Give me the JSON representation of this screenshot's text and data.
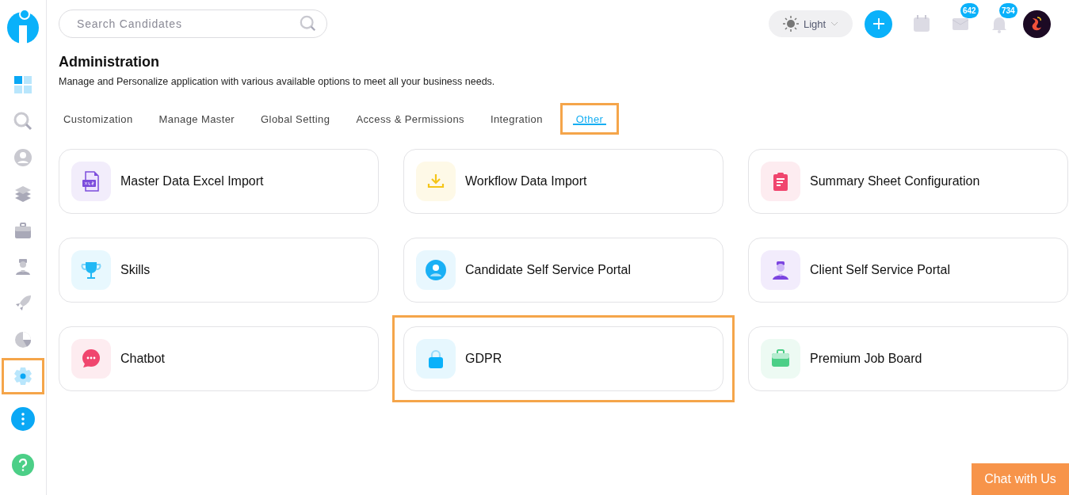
{
  "sidebar": {
    "items": [
      {
        "kind": "dashboard",
        "selected": false,
        "highlighted": false
      },
      {
        "kind": "search",
        "selected": false,
        "highlighted": false
      },
      {
        "kind": "person",
        "selected": false,
        "highlighted": false
      },
      {
        "kind": "layers",
        "selected": false,
        "highlighted": false
      },
      {
        "kind": "briefcase",
        "selected": false,
        "highlighted": false
      },
      {
        "kind": "user",
        "selected": false,
        "highlighted": false
      },
      {
        "kind": "rocket",
        "selected": false,
        "highlighted": false
      },
      {
        "kind": "pie",
        "selected": false,
        "highlighted": false
      },
      {
        "kind": "gear",
        "selected": true,
        "highlighted": true
      }
    ]
  },
  "search": {
    "placeholder": "Search Candidates"
  },
  "theme_toggle": {
    "label": "Light"
  },
  "badges": {
    "mail": "642",
    "notifications": "734"
  },
  "page": {
    "title": "Administration",
    "subtitle": "Manage and Personalize application with various available options to meet all your business needs."
  },
  "tabs": [
    {
      "label": "Customization",
      "selected": false,
      "highlighted": false
    },
    {
      "label": "Manage Master",
      "selected": false,
      "highlighted": false
    },
    {
      "label": "Global Setting",
      "selected": false,
      "highlighted": false
    },
    {
      "label": "Access & Permissions",
      "selected": false,
      "highlighted": false
    },
    {
      "label": "Integration",
      "selected": false,
      "highlighted": false
    },
    {
      "label": "Other",
      "selected": true,
      "highlighted": true
    }
  ],
  "cards": [
    {
      "title": "Master Data Excel Import",
      "kind": "xls",
      "color": "#7c4ddc",
      "highlighted": false
    },
    {
      "title": "Workflow Data Import",
      "kind": "download",
      "color": "#f5c518",
      "highlighted": false
    },
    {
      "title": "Summary Sheet Configuration",
      "kind": "clipboard",
      "color": "#f0466e",
      "highlighted": false
    },
    {
      "title": "Skills",
      "kind": "trophy",
      "color": "#22b8f5",
      "highlighted": false
    },
    {
      "title": "Candidate Self Service Portal",
      "kind": "person",
      "color": "#1ab0f5",
      "highlighted": false
    },
    {
      "title": "Client Self Service Portal",
      "kind": "client",
      "color": "#7c45e0",
      "highlighted": false
    },
    {
      "title": "Chatbot",
      "kind": "chat",
      "color": "#f0466e",
      "highlighted": false
    },
    {
      "title": "GDPR",
      "kind": "lock",
      "color": "#0ab1fa",
      "highlighted": true
    },
    {
      "title": "Premium Job Board",
      "kind": "briefcase",
      "color": "#4ccf87",
      "highlighted": false
    }
  ],
  "chat_button": {
    "label": "Chat with Us"
  }
}
